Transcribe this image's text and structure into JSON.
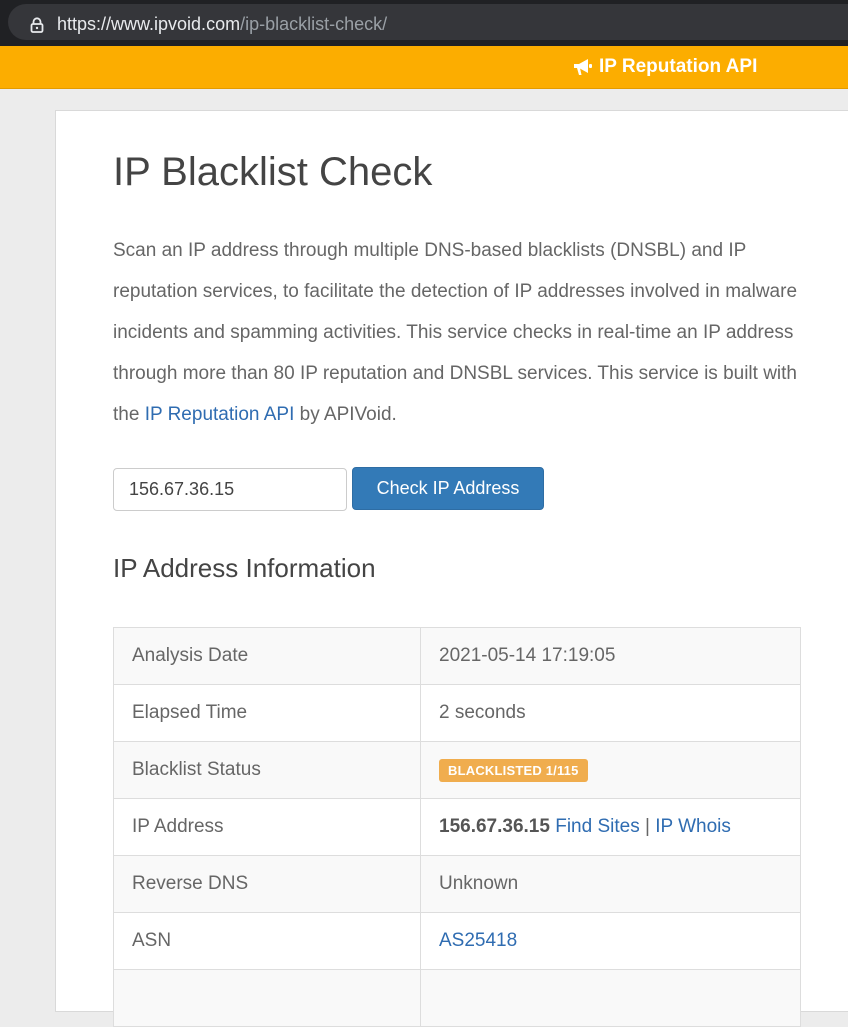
{
  "browser": {
    "url_host": "https://www.ipvoid.com",
    "url_path": "/ip-blacklist-check/"
  },
  "topbar": {
    "api_link": "IP Reputation API",
    "accent_color": "#fcad00"
  },
  "page": {
    "title": "IP Blacklist Check",
    "description_part1": "Scan an IP address through multiple DNS-based blacklists (DNSBL) and IP reputation services, to facilitate the detection of IP addresses involved in malware incidents and spamming activities. This service checks in real-time an IP address through more than 80 IP reputation and DNSBL services. This service is built with the ",
    "description_link": "IP Reputation API",
    "description_part2": " by APIVoid."
  },
  "form": {
    "ip_value": "156.67.36.15",
    "submit_label": "Check IP Address"
  },
  "info": {
    "heading": "IP Address Information",
    "analysis_date_label": "Analysis Date",
    "analysis_date_value": "2021-05-14 17:19:05",
    "elapsed_time_label": "Elapsed Time",
    "elapsed_time_value": "2 seconds",
    "blacklist_status_label": "Blacklist Status",
    "blacklist_status_value": "BLACKLISTED 1/115",
    "ip_address_label": "IP Address",
    "ip_address_value": "156.67.36.15",
    "find_sites_link": "Find Sites",
    "separator": "|",
    "ip_whois_link": "IP Whois",
    "reverse_dns_label": "Reverse DNS",
    "reverse_dns_value": "Unknown",
    "asn_label": "ASN",
    "asn_value": "AS25418"
  }
}
